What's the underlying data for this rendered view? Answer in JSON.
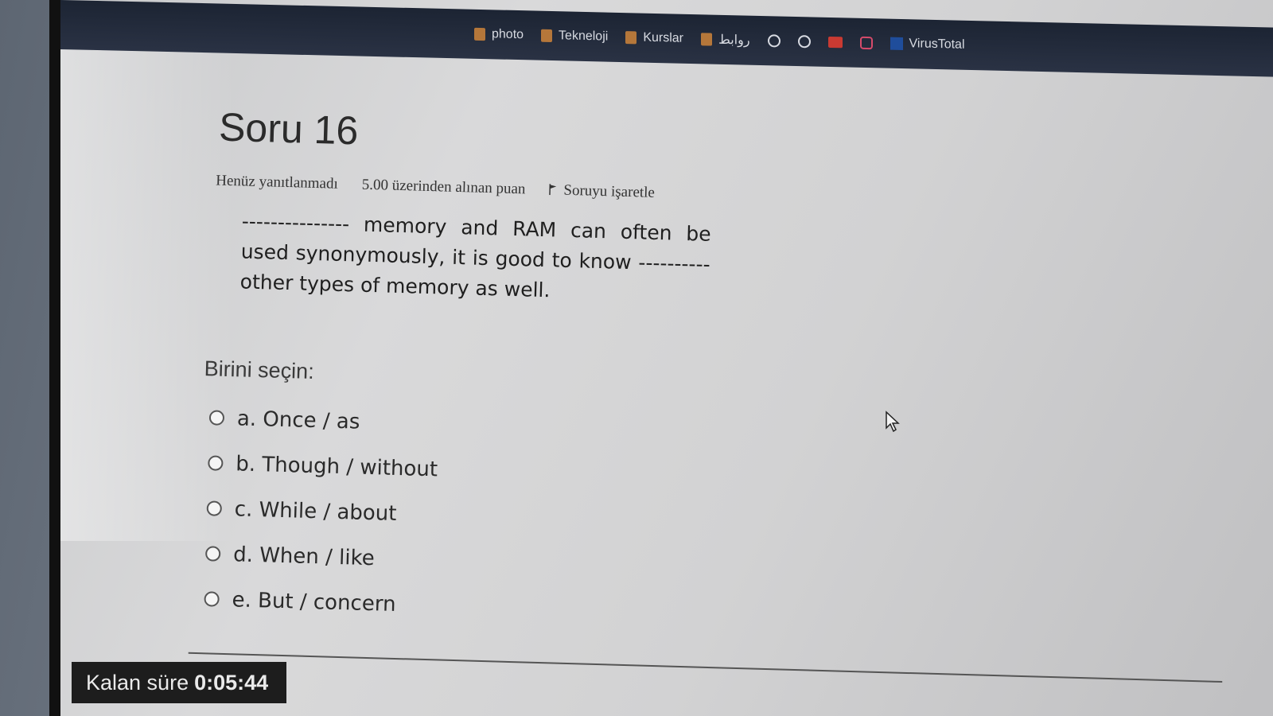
{
  "bookmarks": [
    {
      "label": "photo",
      "icon": "folder-icon"
    },
    {
      "label": "Tekneloji",
      "icon": "folder-icon"
    },
    {
      "label": "Kurslar",
      "icon": "folder-icon"
    },
    {
      "label": "روابط",
      "icon": "folder-icon"
    },
    {
      "label": "VirusTotal",
      "icon": "virustotal-icon"
    }
  ],
  "question": {
    "title": "Soru 16",
    "status": "Henüz yanıtlanmadı",
    "points": "5.00 üzerinden alınan puan",
    "flag_label": "Soruyu işaretle",
    "text": "--------------- memory and RAM can often be used synonymously, it is good to know ---------- other types of memory as well."
  },
  "answer": {
    "prompt": "Birini seçin:",
    "options": [
      {
        "label": "a. Once / as",
        "selected": false
      },
      {
        "label": "b. Though / without",
        "selected": false
      },
      {
        "label": "c. While / about",
        "selected": false
      },
      {
        "label": "d. When / like",
        "selected": false
      },
      {
        "label": "e. But / concern",
        "selected": false
      }
    ]
  },
  "timer": {
    "label": "Kalan süre",
    "value": "0:05:44"
  },
  "colors": {
    "bookmarks_bar": "#1c2433",
    "timer_bg": "#1d1d1d",
    "page_bg": "#d9d9da"
  }
}
